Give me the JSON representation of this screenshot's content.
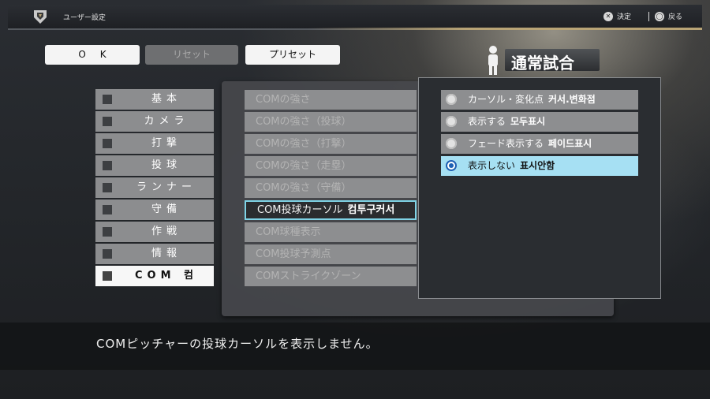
{
  "header": {
    "title": "ユーザー設定",
    "confirm_label": "決定",
    "back_label": "戻る",
    "confirm_icon": "cross-button-icon",
    "back_icon": "circle-button-icon",
    "logo_icon": "team-shield-logo"
  },
  "toolbar": {
    "ok_label": "OK",
    "reset_label": "リセット",
    "preset_label": "プリセット"
  },
  "mode": {
    "label": "通常試合",
    "icon": "player-figure-icon"
  },
  "categories": [
    {
      "label": "基本"
    },
    {
      "label": "カメラ"
    },
    {
      "label": "打撃"
    },
    {
      "label": "投球"
    },
    {
      "label": "ランナー"
    },
    {
      "label": "守備"
    },
    {
      "label": "作戦"
    },
    {
      "label": "情報"
    },
    {
      "label": "COM 컴"
    }
  ],
  "options": [
    {
      "label": "COMの強さ"
    },
    {
      "label": "COMの強さ（投球）"
    },
    {
      "label": "COMの強さ（打撃）"
    },
    {
      "label": "COMの強さ（走塁）"
    },
    {
      "label": "COMの強さ（守備）"
    },
    {
      "label": "COM投球カーソル",
      "extra": "컴투구커서"
    },
    {
      "label": "COM球種表示"
    },
    {
      "label": "COM投球予測点"
    },
    {
      "label": "COMストライクゾーン"
    }
  ],
  "choices": [
    {
      "label": "カーソル・変化点",
      "extra": "커서.변화점"
    },
    {
      "label": "表示する",
      "extra": "모두표시"
    },
    {
      "label": "フェード表示する",
      "extra": "페이드표시"
    },
    {
      "label": "表示しない",
      "extra": "표시안함"
    }
  ],
  "description": "COMピッチャーの投球カーソルを表示しません。",
  "colors": {
    "selection_highlight": "#a6e0f3",
    "selected_border": "#7fd3e6",
    "accent_gold": "#b8a476"
  }
}
